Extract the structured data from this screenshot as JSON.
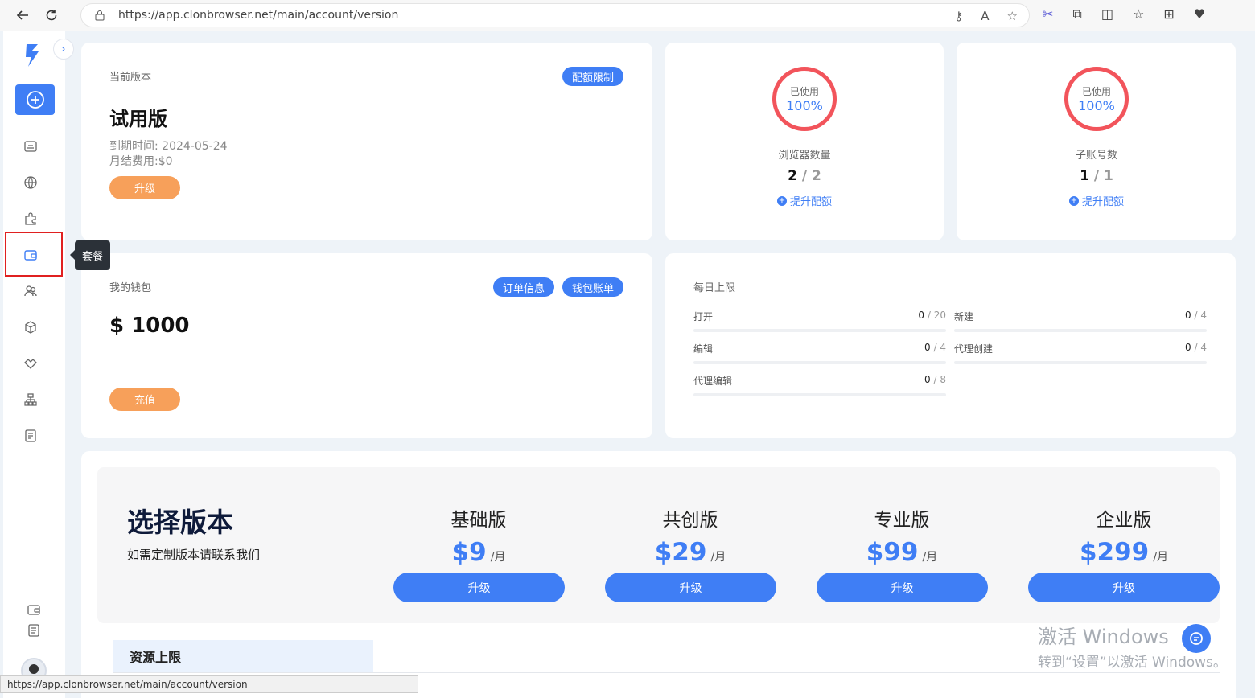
{
  "browser": {
    "url": "https://app.clonbrowser.net/main/account/version",
    "status_url": "https://app.clonbrowser.net/main/account/version"
  },
  "sidebar": {
    "tooltip": "套餐",
    "items": [
      {
        "icon": "dashboard-icon"
      },
      {
        "icon": "globe-icon"
      },
      {
        "icon": "puzzle-icon"
      },
      {
        "icon": "wallet-icon",
        "active": true
      },
      {
        "icon": "users-icon"
      },
      {
        "icon": "cube-icon"
      },
      {
        "icon": "handshake-icon"
      },
      {
        "icon": "org-chart-icon"
      },
      {
        "icon": "document-icon"
      }
    ]
  },
  "current_version": {
    "label": "当前版本",
    "quota_limit_pill": "配额限制",
    "plan_name": "试用版",
    "expire": "到期时间: 2024-05-24",
    "monthly_fee": "月结费用:$0",
    "upgrade_button": "升级"
  },
  "browser_quota": {
    "used_label": "已使用",
    "percent": "100%",
    "title": "浏览器数量",
    "used": "2",
    "total": "/ 2",
    "link": "提升配额"
  },
  "subaccount_quota": {
    "used_label": "已使用",
    "percent": "100%",
    "title": "子账号数",
    "used": "1",
    "total": "/ 1",
    "link": "提升配额"
  },
  "wallet": {
    "label": "我的钱包",
    "order_info": "订单信息",
    "wallet_bill": "钱包账单",
    "balance": "$ 1000",
    "recharge_button": "充值"
  },
  "daily_limit": {
    "title": "每日上限",
    "rows": [
      {
        "name": "打开",
        "used": "0",
        "total": " / 20",
        "fraction": 0
      },
      {
        "name": "新建",
        "used": "0",
        "total": " / 4",
        "fraction": 0
      },
      {
        "name": "编辑",
        "used": "0",
        "total": " / 4",
        "fraction": 0
      },
      {
        "name": "代理创建",
        "used": "0",
        "total": " / 4",
        "fraction": 0
      },
      {
        "name": "代理编辑",
        "used": "0",
        "total": " / 8",
        "fraction": 0
      }
    ]
  },
  "plans": {
    "heading": "选择版本",
    "subtext": "如需定制版本请联系我们",
    "items": [
      {
        "name": "基础版",
        "price": "$9",
        "unit": "/月",
        "button": "升级"
      },
      {
        "name": "共创版",
        "price": "$29",
        "unit": "/月",
        "button": "升级"
      },
      {
        "name": "专业版",
        "price": "$99",
        "unit": "/月",
        "button": "升级"
      },
      {
        "name": "企业版",
        "price": "$299",
        "unit": "/月",
        "button": "升级"
      }
    ],
    "resources_tab": "资源上限"
  },
  "watermark": {
    "line1": "激活 Windows",
    "line2": "转到“设置”以激活 Windows。"
  }
}
